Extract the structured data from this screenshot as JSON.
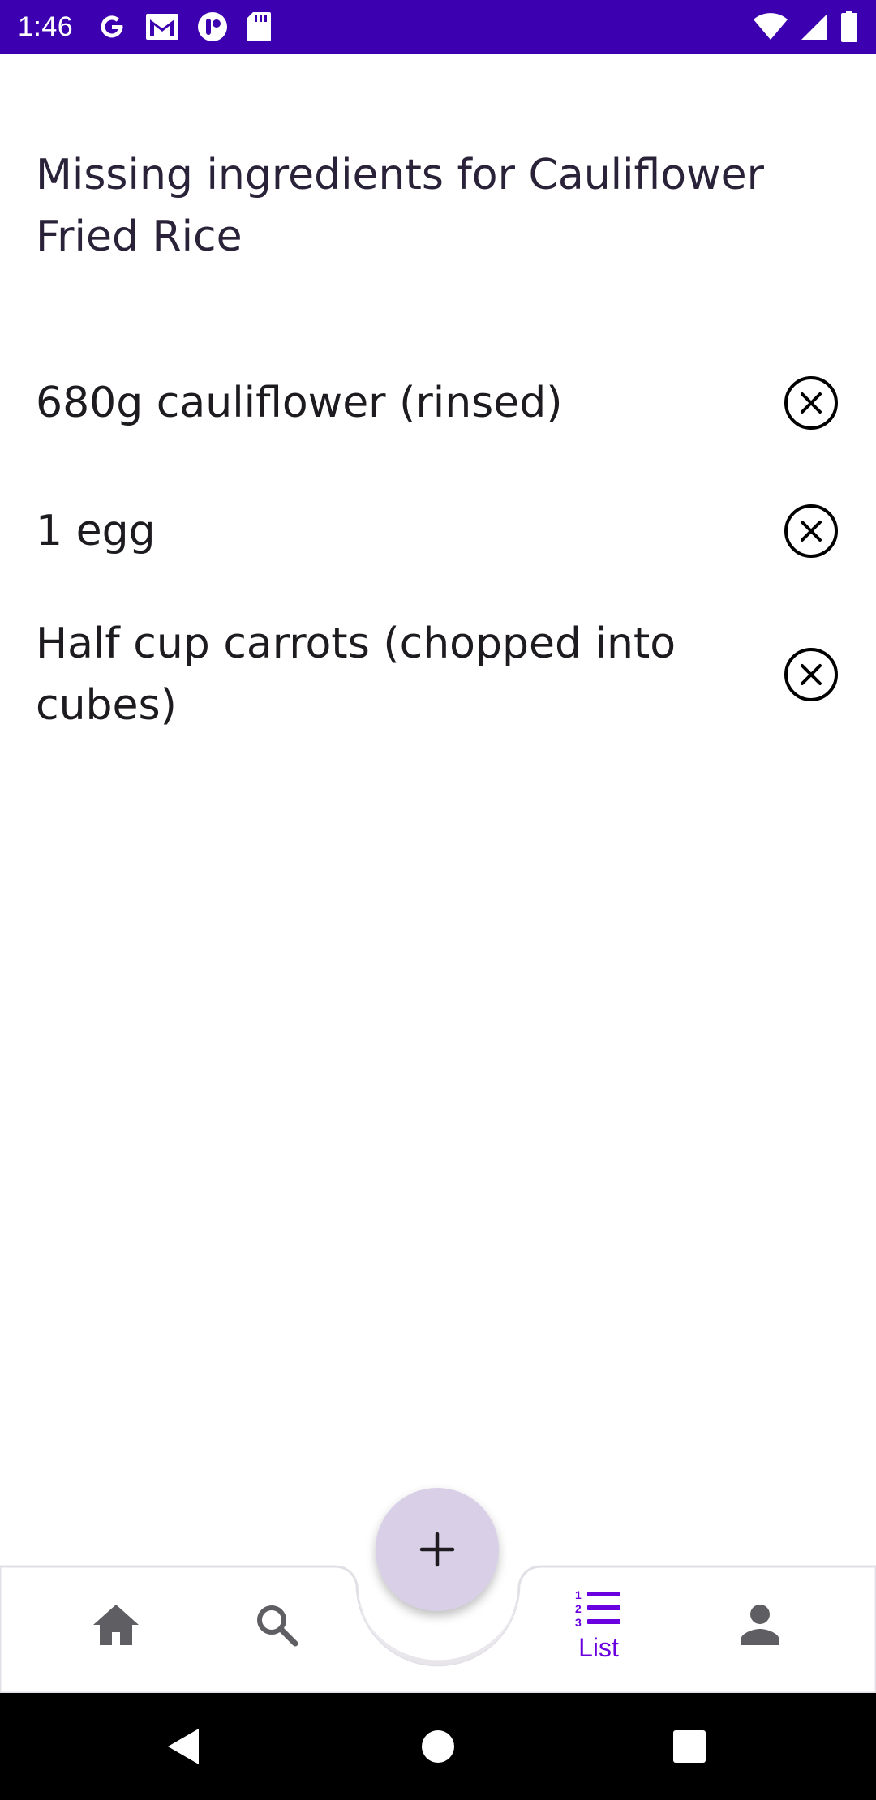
{
  "status_bar": {
    "time": "1:46",
    "background": "#3d00b0",
    "left_icons": [
      "google-icon",
      "gmail-icon",
      "app-notification-icon",
      "sd-card-icon"
    ],
    "right_icons": [
      "wifi-icon",
      "cell-signal-icon",
      "battery-icon"
    ]
  },
  "page": {
    "title": "Missing ingredients for Cauliflower Fried Rice"
  },
  "ingredients": [
    {
      "text": "680g cauliflower (rinsed)"
    },
    {
      "text": "1 egg"
    },
    {
      "text": "Half cup carrots (chopped into cubes)"
    }
  ],
  "bottom_nav": {
    "accent": "#6a00e0",
    "items": [
      {
        "id": "home",
        "icon": "home-icon",
        "label": ""
      },
      {
        "id": "search",
        "icon": "search-icon",
        "label": ""
      },
      {
        "id": "list",
        "icon": "list-icon",
        "label": "List",
        "selected": true
      },
      {
        "id": "profile",
        "icon": "person-icon",
        "label": ""
      }
    ]
  },
  "fab": {
    "icon": "plus-icon",
    "background": "#d9d0e8"
  },
  "system_nav": {
    "buttons": [
      "back-icon",
      "home-circle-icon",
      "recents-icon"
    ]
  }
}
